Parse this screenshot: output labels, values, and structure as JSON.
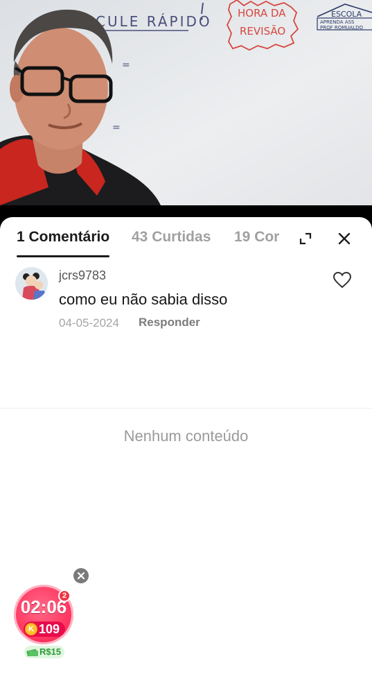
{
  "video": {
    "board_text_top": "CULE RÁPIDO",
    "board_text_sign": "HORA DA REVISÃO",
    "board_text_logo_title": "ESCOLA",
    "board_text_logo_line1": "APRENDA ASS",
    "board_text_logo_line2": "PROF ROMUALDO",
    "board_equal_1": "=",
    "board_equal_2": "="
  },
  "tabs": [
    {
      "label": "1 Comentário",
      "active": true
    },
    {
      "label": "43 Curtidas",
      "active": false
    },
    {
      "label": "19 Cor",
      "active": false
    }
  ],
  "header_icons": {
    "expand": "expand-icon",
    "close": "close-icon"
  },
  "comment": {
    "username": "jcrs9783",
    "text": "como eu não sabia disso",
    "date": "04-05-2024",
    "reply_label": "Responder",
    "like_icon": "heart-outline-icon"
  },
  "empty_state": "Nenhum conteúdo",
  "widget": {
    "badge": "2",
    "timer": "02:06",
    "coin_symbol": "K",
    "coins": "109",
    "money": "R$15"
  },
  "colors": {
    "accent_pink": "#ff3b63",
    "money_green": "#2e9b36",
    "text_dark": "#1b1b1b",
    "text_muted": "#a0a0a0"
  }
}
